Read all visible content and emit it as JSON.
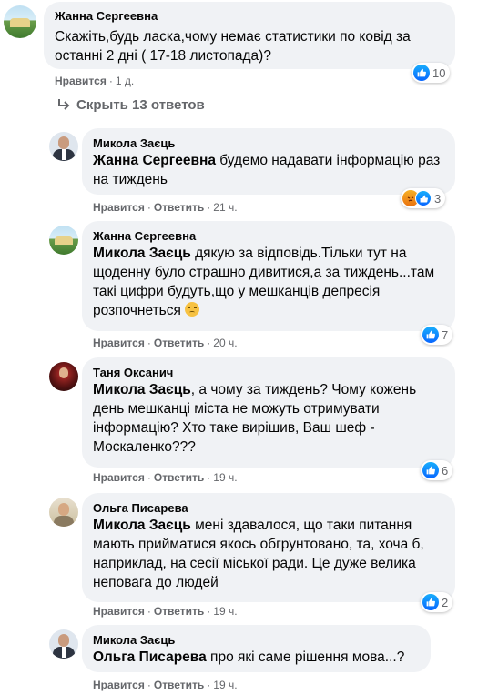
{
  "top_comment": {
    "author": "Жанна Сергеевна",
    "text": "Скажіть,будь ласка,чому немає статистики по ковід за останні 2 дні ( 17-18 листопада)?",
    "like_label": "Нравится",
    "time": "1 д.",
    "reaction_count": "10"
  },
  "replies_toggle": {
    "label": "Скрыть 13 ответов"
  },
  "replies": [
    {
      "author": "Микола Заєць",
      "mention": "Жанна Сергеевна",
      "text": " будемо надавати інформацію раз на тиждень",
      "like_label": "Нравится",
      "reply_label": "Ответить",
      "time": "21 ч.",
      "reaction_count": "3"
    },
    {
      "author": "Жанна Сергеевна",
      "mention": "Микола Заєць",
      "text": " дякую за відповідь.Тільки тут на щоденну було страшно дивитися,а за тиждень...там такі цифри будуть,що у мешканців депресія розпочнеться",
      "like_label": "Нравится",
      "reply_label": "Ответить",
      "time": "20 ч.",
      "reaction_count": "7"
    },
    {
      "author": "Таня Оксанич",
      "mention": "Микола Заєць",
      "text": ", а чому за тиждень? Чому кожень день мешканці міста не можуть отримувати інформацію? Хто таке вирішив, Ваш шеф - Москаленко???",
      "like_label": "Нравится",
      "reply_label": "Ответить",
      "time": "19 ч.",
      "reaction_count": "6"
    },
    {
      "author": "Ольга Писарева",
      "mention": "Микола Заєць",
      "text": " мені здавалося, що таки питання мають прийматися якось обгрунтовано, та, хоча б, наприклад, на сесії міської ради. Це дуже велика неповага до людей",
      "like_label": "Нравится",
      "reply_label": "Ответить",
      "time": "19 ч.",
      "reaction_count": "2"
    },
    {
      "author": "Микола Заєць",
      "mention": "Ольга Писарева",
      "text": " про які саме рішення мова...?",
      "like_label": "Нравится",
      "reply_label": "Ответить",
      "time": "19 ч."
    }
  ],
  "icons": {
    "like": "like-icon",
    "angry": "angry-icon",
    "sad": "sad-face-icon",
    "collapse": "collapse-arrow-icon"
  },
  "colors": {
    "bubble": "#f0f2f5",
    "meta": "#65676b",
    "like_blue": "#0866ff"
  }
}
